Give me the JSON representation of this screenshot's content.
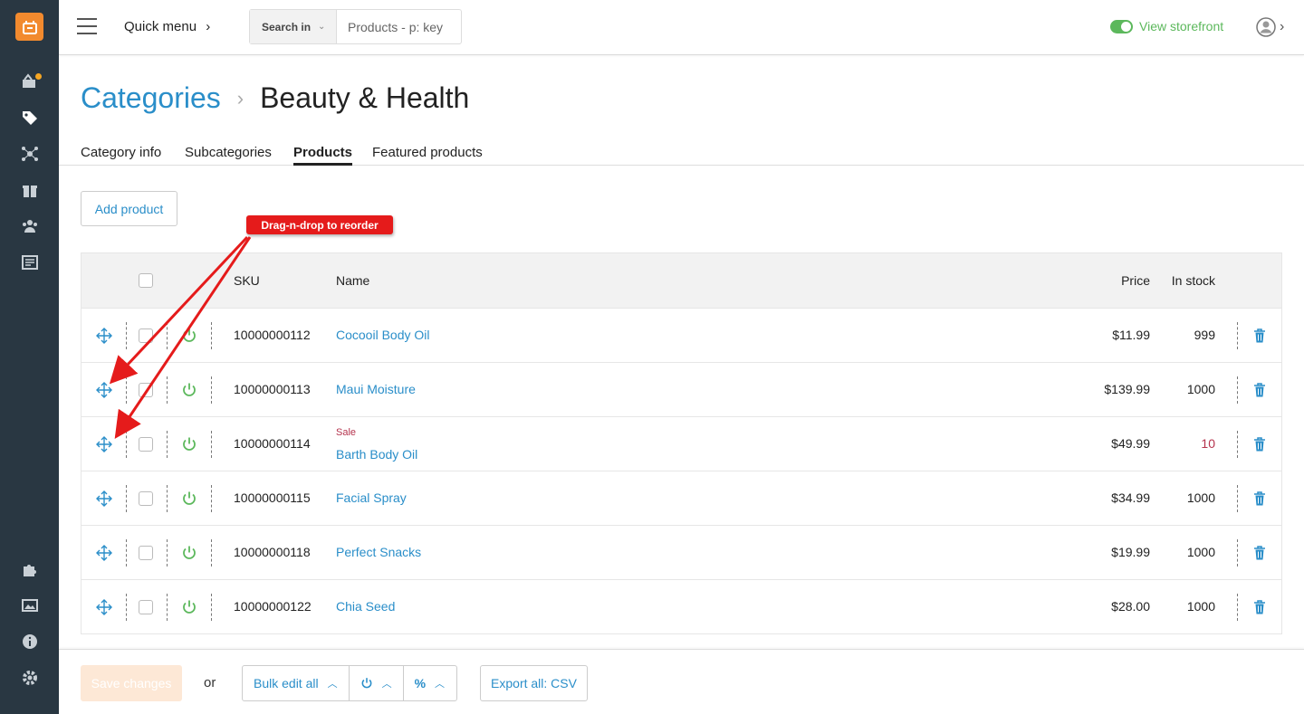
{
  "topbar": {
    "quick_menu": "Quick menu",
    "search_in_label": "Search in",
    "search_placeholder": "Products - p: key",
    "storefront_label": "View storefront"
  },
  "breadcrumb": {
    "parent": "Categories",
    "current": "Beauty & Health"
  },
  "tabs": [
    {
      "label": "Category info"
    },
    {
      "label": "Subcategories"
    },
    {
      "label": "Products",
      "active": true
    },
    {
      "label": "Featured products"
    }
  ],
  "add_product_label": "Add product",
  "annotation": "Drag-n-drop to reorder",
  "table": {
    "headers": {
      "sku": "SKU",
      "name": "Name",
      "price": "Price",
      "in_stock": "In stock"
    },
    "rows": [
      {
        "sku": "10000000112",
        "name": "Cocooil Body Oil",
        "price": "$11.99",
        "stock": "999",
        "sale": "",
        "low_stock": false
      },
      {
        "sku": "10000000113",
        "name": "Maui Moisture",
        "price": "$139.99",
        "stock": "1000",
        "sale": "",
        "low_stock": false
      },
      {
        "sku": "10000000114",
        "name": "Barth Body Oil",
        "price": "$49.99",
        "stock": "10",
        "sale": "Sale",
        "low_stock": true
      },
      {
        "sku": "10000000115",
        "name": "Facial Spray",
        "price": "$34.99",
        "stock": "1000",
        "sale": "",
        "low_stock": false
      },
      {
        "sku": "10000000118",
        "name": "Perfect Snacks",
        "price": "$19.99",
        "stock": "1000",
        "sale": "",
        "low_stock": false
      },
      {
        "sku": "10000000122",
        "name": "Chia Seed",
        "price": "$28.00",
        "stock": "1000",
        "sale": "",
        "low_stock": false
      }
    ]
  },
  "footer": {
    "save_label": "Save changes",
    "or_label": "or",
    "bulk_edit_label": "Bulk edit all",
    "export_label": "Export all: CSV"
  },
  "colors": {
    "accent": "#2a8ec9",
    "sidebar": "#293742",
    "brand": "#f28a2e",
    "success": "#5cb85c",
    "annotation": "#e51b1b",
    "low_stock": "#b5334d"
  },
  "icons": {
    "sidebar": [
      "orders-icon",
      "catalog-icon",
      "network-icon",
      "gift-icon",
      "users-icon",
      "content-icon",
      "modules-icon",
      "images-icon",
      "info-icon",
      "settings-icon"
    ],
    "row": [
      "move-icon",
      "power-icon",
      "trash-icon"
    ]
  }
}
